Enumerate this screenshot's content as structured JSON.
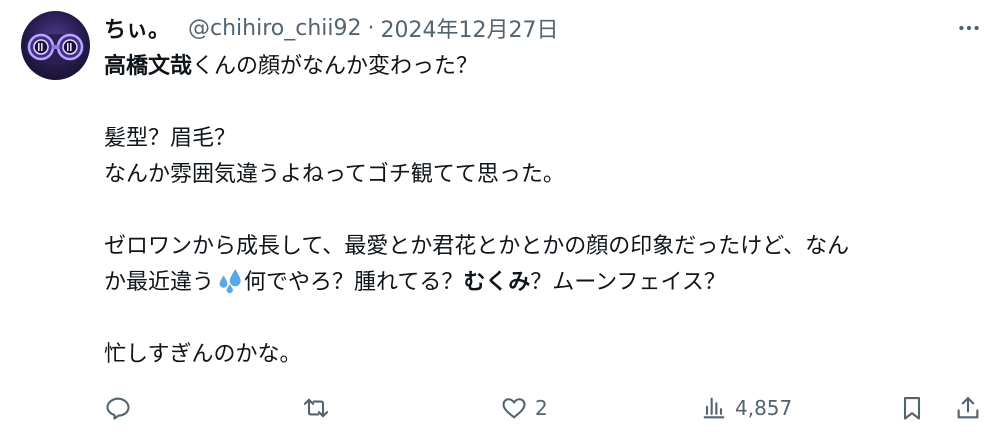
{
  "tweet": {
    "display_name": "ちぃ。",
    "handle": "@chihiro_chii92",
    "separator": "·",
    "date": "2024年12月27日",
    "lines": {
      "l1_bold": "高橋文哉",
      "l1_rest": "くんの顔がなんか変わった？",
      "l2": "髪型？眉毛？",
      "l3": "なんか雰囲気違うよねってゴチ観てて思った。",
      "l4": "ゼロワンから成長して、最愛とか君花とかとかの顔の印象だったけど、なん",
      "l5_a": "か最近違う",
      "l5_b": "何でやろ？腫れてる？",
      "l5_bold": "むくみ",
      "l5_c": "？ムーンフェイス？",
      "l6": "忙しすぎんのかな。"
    },
    "emoji": "sweat-droplets-emoji",
    "actions": {
      "reply_count": "",
      "retweet_count": "",
      "like_count": "2",
      "views_count": "4,857"
    }
  },
  "icons": {
    "more": "more-icon",
    "reply": "reply-icon",
    "retweet": "retweet-icon",
    "like": "heart-icon",
    "views": "views-icon",
    "bookmark": "bookmark-icon",
    "share": "share-icon"
  },
  "colors": {
    "text": "#0f1419",
    "muted": "#536471",
    "emoji_blue": "#5aa9e6"
  }
}
